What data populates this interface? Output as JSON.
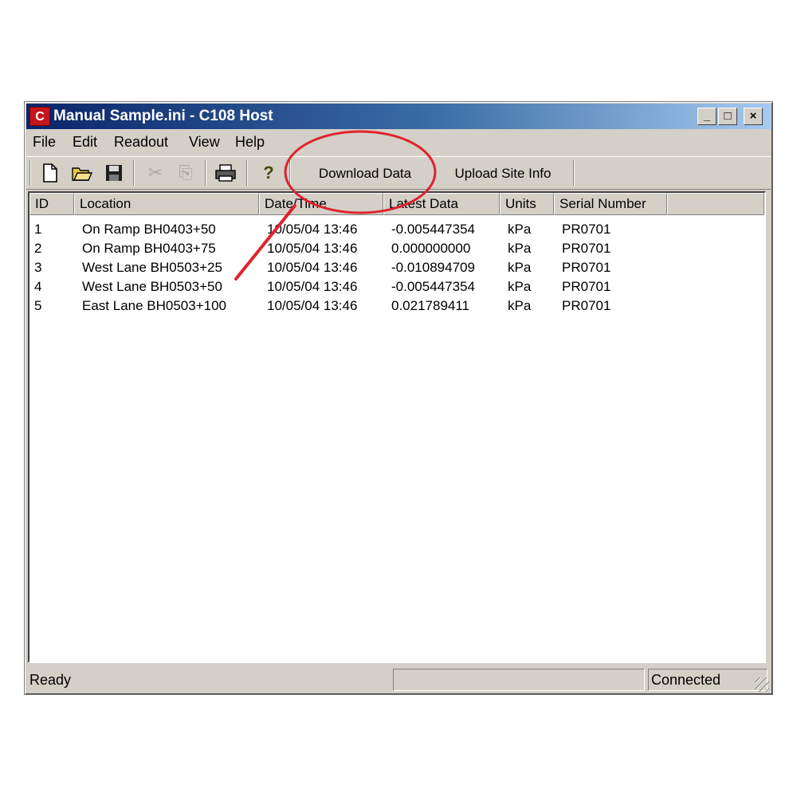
{
  "window": {
    "icon_text": "C",
    "title": "Manual Sample.ini - C108 Host",
    "controls": {
      "minimize": "_",
      "maximize": "□",
      "close": "×"
    }
  },
  "menu": [
    "File",
    "Edit",
    "Readout",
    "View",
    "Help"
  ],
  "toolbar": {
    "icons": [
      "new-icon",
      "open-folder-icon",
      "save-icon",
      "cut-icon",
      "copy-icon",
      "print-icon",
      "help-icon"
    ],
    "download_label": "Download Data",
    "upload_label": "Upload Site Info"
  },
  "table": {
    "columns": [
      "ID",
      "Location",
      "Date/Time",
      "Latest Data",
      "Units",
      "Serial Number"
    ],
    "rows": [
      [
        "1",
        "On Ramp BH0403+50",
        "10/05/04 13:46",
        "-0.005447354",
        "kPa",
        "PR0701"
      ],
      [
        "2",
        "On Ramp BH0403+75",
        "10/05/04 13:46",
        "0.000000000",
        "kPa",
        "PR0701"
      ],
      [
        "3",
        "West Lane BH0503+25",
        "10/05/04 13:46",
        "-0.010894709",
        "kPa",
        "PR0701"
      ],
      [
        "4",
        "West Lane BH0503+50",
        "10/05/04 13:46",
        "-0.005447354",
        "kPa",
        "PR0701"
      ],
      [
        "5",
        "East Lane BH0503+100",
        "10/05/04 13:46",
        "0.021789411",
        "kPa",
        "PR0701"
      ]
    ]
  },
  "status": {
    "left": "Ready",
    "middle": "",
    "right": "Connected"
  },
  "annotation": {
    "color": "#e0232e"
  }
}
